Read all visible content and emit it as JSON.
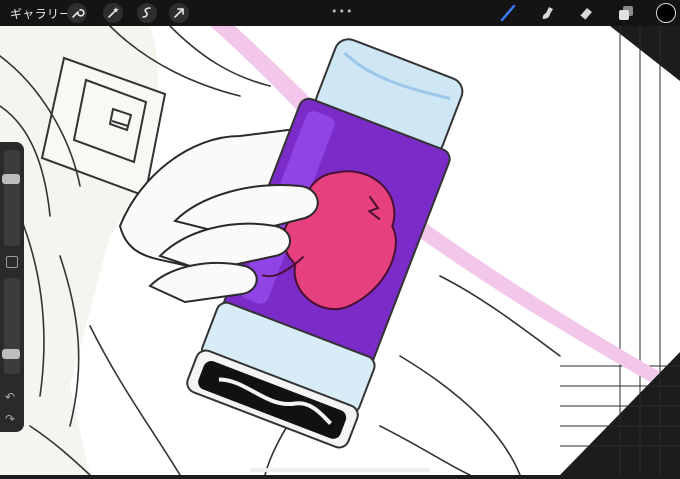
{
  "toolbar": {
    "gallery_label": "ギャラリー",
    "left_icons": [
      "wrench-icon",
      "magic-wand-icon",
      "selection-icon",
      "transform-arrow-icon"
    ],
    "right_tools": [
      "brush-icon",
      "smudge-icon",
      "eraser-icon",
      "layers-icon"
    ],
    "more_label": "•••",
    "active_tool": "brush",
    "active_color": "#000000",
    "brush_accent": "#3b7cff"
  },
  "sidebar": {
    "undo_label": "↶",
    "redo_label": "↷",
    "size_level": 0.72,
    "opacity_level": 0.18
  },
  "colors": {
    "bottle_cap": "#cfe6f5",
    "bottle_purple": "#7a2bc8",
    "creature_pink": "#e6407f",
    "stripe_pink": "#f3c7ea",
    "canvas": "#ffffff",
    "background": "#1c1c1e"
  }
}
